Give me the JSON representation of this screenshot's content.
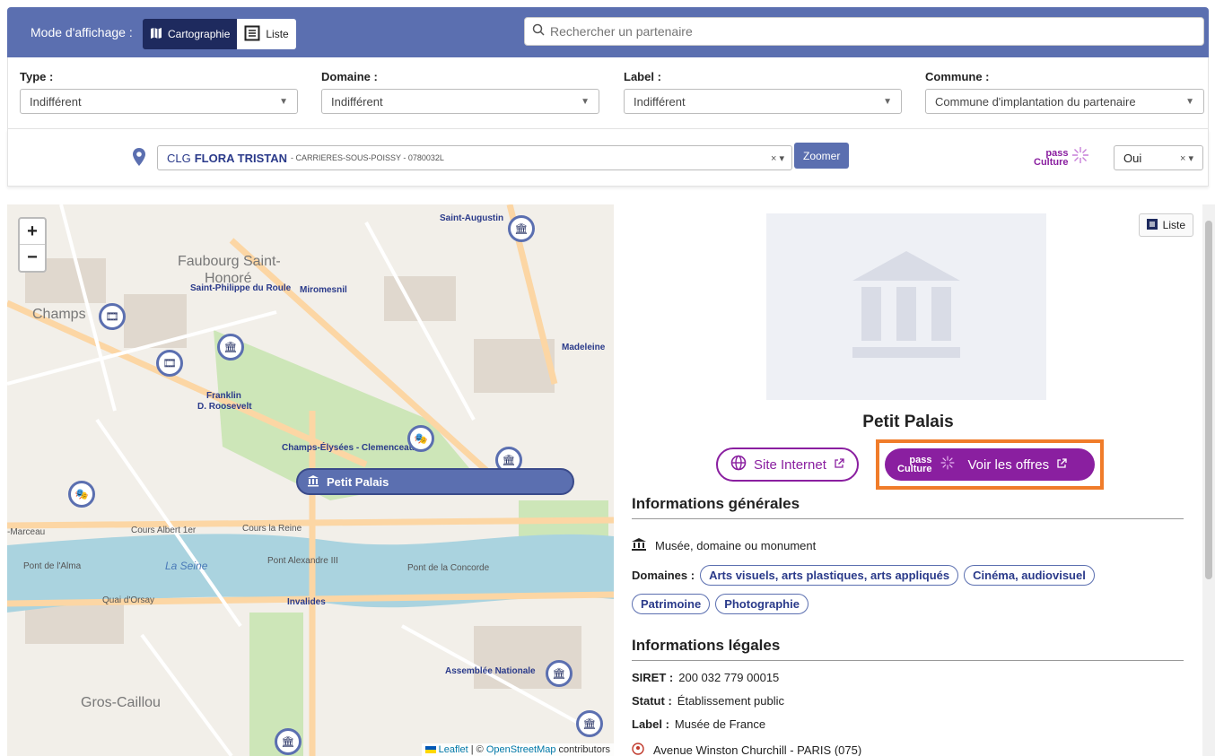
{
  "header": {
    "mode_label": "Mode d'affichage :",
    "mode_carto": "Cartographie",
    "mode_liste": "Liste",
    "search_placeholder": "Rechercher un partenaire"
  },
  "filters": [
    {
      "label": "Type :",
      "value": "Indifférent"
    },
    {
      "label": "Domaine :",
      "value": "Indifférent"
    },
    {
      "label": "Label :",
      "value": "Indifférent"
    },
    {
      "label": "Commune :",
      "value": "Commune d'implantation du partenaire"
    }
  ],
  "etablissement": {
    "prefix": "CLG",
    "name": "FLORA TRISTAN",
    "sub": "- CARRIERES-SOUS-POISSY - 0780032L",
    "clear": "× ▾",
    "zoom_label": "Zoomer"
  },
  "pass_culture": {
    "logo_top": "pass",
    "logo_bottom": "Culture",
    "value": "Oui",
    "clear": "× ▾"
  },
  "map": {
    "popup_label": "Petit Palais",
    "attribution_leaflet": "Leaflet",
    "attribution_sep": " | © ",
    "attribution_osm": "OpenStreetMap",
    "attribution_tail": " contributors",
    "labels": {
      "faubourg": "Faubourg Saint-",
      "honore": "Honoré",
      "champs": "Champs",
      "elysees": "Élysées",
      "gros_caillou": "Gros-Caillou",
      "miromesnil": "Miromesnil",
      "franklin": "Franklin",
      "roosevelt": "D. Roosevelt",
      "champs_elysees_st": "Champs-Élysées - Clemenceau",
      "madeleine": "Madeleine",
      "invalides": "Invalides",
      "concorde": "Pont de la Concorde",
      "alma": "Pont de l'Alma",
      "assemblee": "Assemblée Nationale",
      "cours_reine": "Cours la Reine",
      "albert": "Cours Albert 1er",
      "orsay": "Quai d'Orsay",
      "seine": "La Seine",
      "alexandre": "Pont Alexandre III",
      "saint_augustin": "Saint-Augustin",
      "marceau": "-Marceau",
      "saint_philippe": "Saint-Philippe du Roule"
    }
  },
  "panel": {
    "liste_label": "Liste",
    "title": "Petit Palais",
    "site_label": "Site Internet",
    "offres_label": "Voir les offres",
    "offres_logo_top": "pass",
    "offres_logo_bottom": "Culture",
    "general_heading": "Informations générales",
    "category": "Musée, domaine ou monument",
    "domaines_label": "Domaines :",
    "domaines": [
      "Arts visuels, arts plastiques, arts appliqués",
      "Cinéma, audiovisuel",
      "Patrimoine",
      "Photographie"
    ],
    "legal_heading": "Informations légales",
    "siret_label": "SIRET :",
    "siret": "200 032 779 00015",
    "statut_label": "Statut :",
    "statut": "Établissement public",
    "label_label": "Label :",
    "label_value": "Musée de France",
    "address": "Avenue Winston Churchill - PARIS (075)"
  },
  "colors": {
    "primary": "#5b6fb0",
    "dark": "#1e2a5e",
    "pass_purple": "#8a1fa0",
    "highlight": "#f07c2a"
  }
}
